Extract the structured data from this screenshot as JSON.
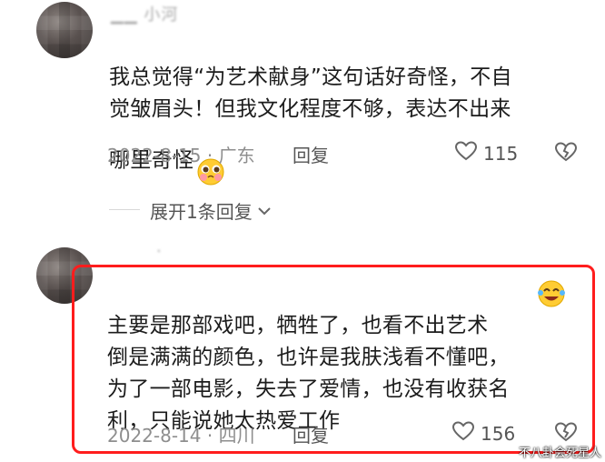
{
  "comments": [
    {
      "username": "▁▁ 小河",
      "text": "我总觉得“为艺术献身”这句话好奇怪，不自\n觉皱眉头！但我文化程度不够，表达不出来\n哪里奇怪",
      "emoji": "pleading-face-emoji",
      "date": "2022-8-15",
      "location": "广东",
      "reply_label": "回复",
      "likes": "115"
    },
    {
      "username": "·",
      "text": "主要是那部戏吧，牺牲了，也看不出艺术\n倒是满满的颜色，也许是我肤浅看不懂吧，\n为了一部电影，失去了爱情，也没有收获名\n利，只能说她太热爱工作",
      "emoji": "laughing-tears-emoji",
      "date": "2022-8-14",
      "location": "四川",
      "reply_label": "回复",
      "likes": "156"
    }
  ],
  "expand_replies": "展开1条回复",
  "separator": "·",
  "watermark": "不八卦会死星人",
  "colors": {
    "highlight": "#ff1d1d",
    "meta": "#8e8e8e"
  }
}
